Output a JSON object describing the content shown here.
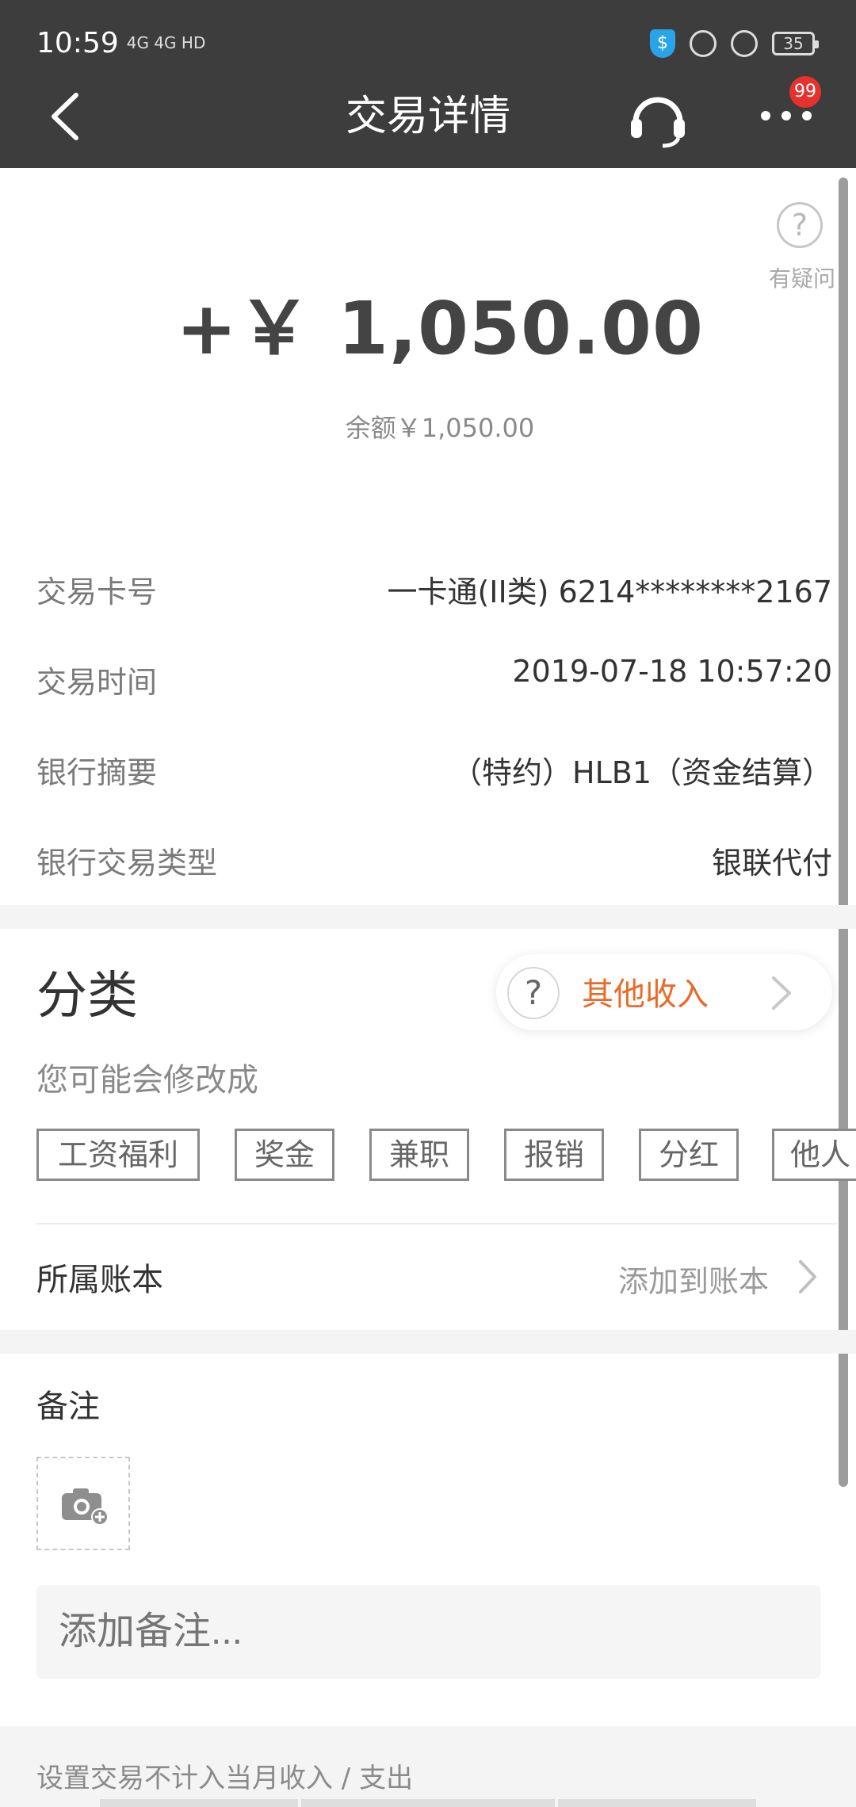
{
  "status_bar": {
    "time": "10:59",
    "indicators": "4G 4G HD",
    "battery": "35"
  },
  "header": {
    "title": "交易详情",
    "badge": "99"
  },
  "help": {
    "label": "有疑问"
  },
  "amount": {
    "value": "+￥ 1,050.00",
    "balance": "余额￥1,050.00"
  },
  "details": [
    {
      "label": "交易卡号",
      "value": "一卡通(II类) 6214********2167"
    },
    {
      "label": "交易时间",
      "value": "2019-07-18 10:57:20"
    },
    {
      "label": "银行摘要",
      "value": "（特约）HLB1（资金结算）"
    },
    {
      "label": "银行交易类型",
      "value": "银联代付"
    }
  ],
  "category": {
    "title": "分类",
    "selected": "其他收入",
    "suggest_label": "您可能会修改成",
    "chips": [
      "工资福利",
      "奖金",
      "兼职",
      "报销",
      "分红",
      "他人"
    ]
  },
  "account_book": {
    "label": "所属账本",
    "value": "添加到账本"
  },
  "note": {
    "title": "备注",
    "placeholder": "添加备注..."
  },
  "exclude_text": "设置交易不计入当月收入 / 支出",
  "colors": {
    "header_bg": "#3d3d3d",
    "accent_orange": "#ea6b28",
    "badge_red": "#e6312e"
  }
}
